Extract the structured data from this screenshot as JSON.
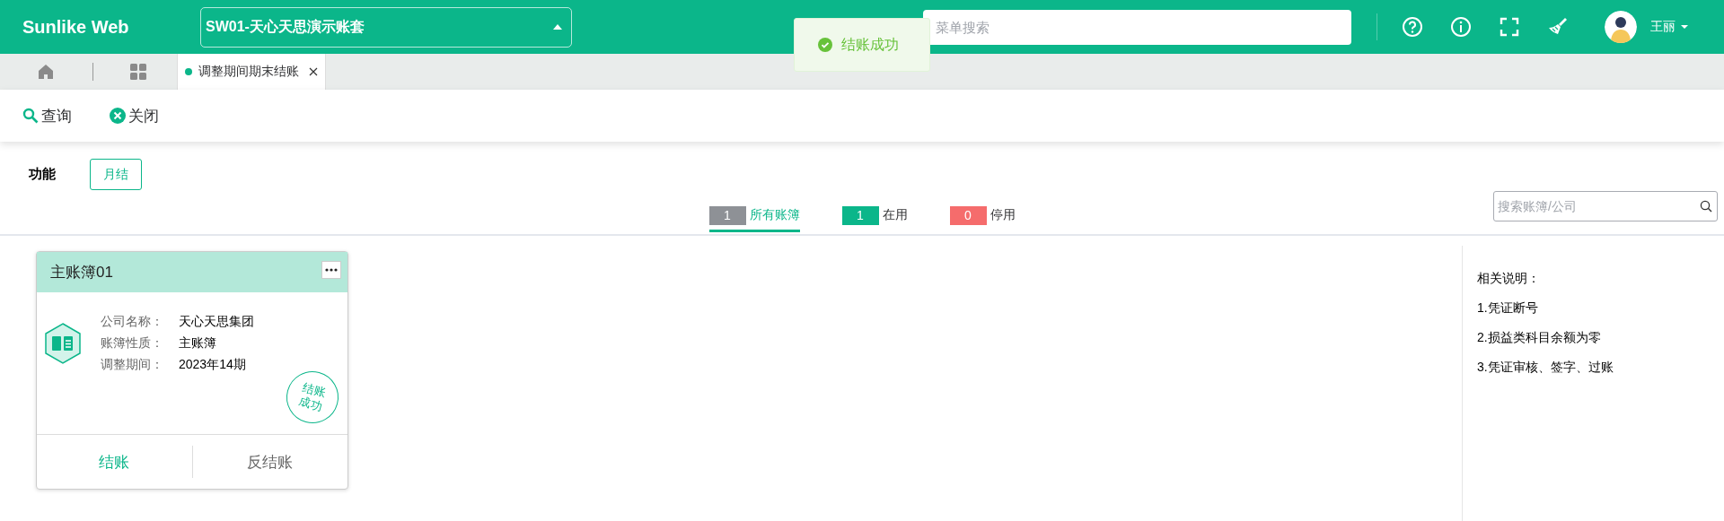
{
  "header": {
    "logo": "Sunlike Web",
    "account_select": "SW01-天心天思演示账套",
    "search": {
      "placeholder": "菜单搜索"
    },
    "user": {
      "name": "王丽"
    }
  },
  "toast": {
    "text": "结账成功"
  },
  "tabs": [
    {
      "label": "调整期间期末结账",
      "selected": true
    }
  ],
  "toolbar": [
    {
      "label": "查询",
      "kind": "search"
    },
    {
      "label": "关闭",
      "kind": "close"
    }
  ],
  "function_label": "功能",
  "function_buttons": [
    "月结"
  ],
  "filters": [
    {
      "count": "1",
      "label": "所有账簿",
      "selected": true,
      "color": "#8e9196"
    },
    {
      "count": "1",
      "label": "在用",
      "selected": false,
      "color": "#0bb68a"
    },
    {
      "count": "0",
      "label": "停用",
      "selected": false,
      "color": "#f56c6c"
    }
  ],
  "ledger_search": {
    "placeholder": "搜索账簿/公司"
  },
  "ledgers": [
    {
      "title": "主账簿01",
      "fields": [
        {
          "label": "公司名称：",
          "value": "天心天思集团"
        },
        {
          "label": "账簿性质：",
          "value": "主账簿"
        },
        {
          "label": "调整期间：",
          "value": "2023年14期"
        }
      ],
      "stamp": "结账成功",
      "actions": [
        {
          "label": "结账",
          "primary": true
        },
        {
          "label": "反结账",
          "primary": false
        }
      ]
    }
  ],
  "notes": {
    "title": "相关说明：",
    "items": [
      "1.凭证断号",
      "2.损益类科目余额为零",
      "3.凭证审核、签字、过账"
    ]
  }
}
